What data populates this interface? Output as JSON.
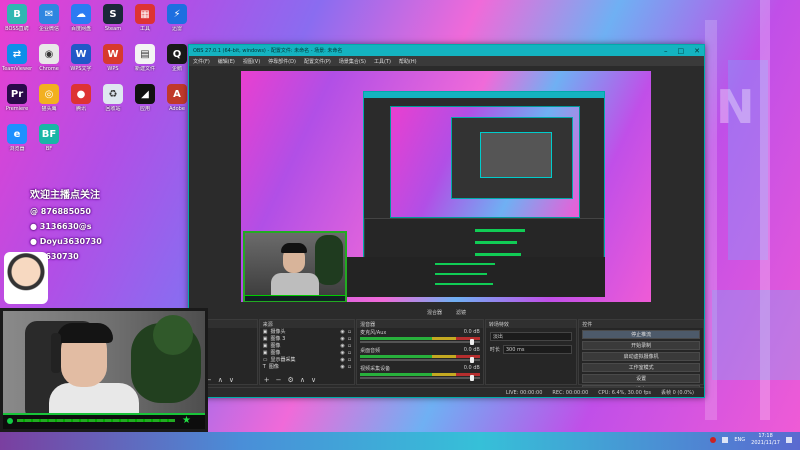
{
  "desktop": {
    "icons": [
      {
        "label": "BOSS直聘",
        "color": "#2fb7b2",
        "glyph": "B",
        "name": "boss-icon"
      },
      {
        "label": "企业微信",
        "color": "#2f86e0",
        "glyph": "✉",
        "name": "wecom-icon"
      },
      {
        "label": "百度网盘",
        "color": "#2c7bf2",
        "glyph": "☁",
        "name": "baidu-pan-icon"
      },
      {
        "label": "Steam",
        "color": "#1b2838",
        "glyph": "S",
        "name": "steam-icon"
      },
      {
        "label": "工具",
        "color": "#d33",
        "glyph": "▦",
        "name": "tool-icon"
      },
      {
        "label": "迅雷",
        "color": "#1d6fe0",
        "glyph": "⚡",
        "name": "xunlei-icon"
      },
      {
        "label": "TeamViewer",
        "color": "#0e8ee9",
        "glyph": "⇄",
        "name": "teamviewer-icon"
      },
      {
        "label": "Chrome",
        "color": "#e8e8e8",
        "glyph": "◉",
        "name": "chrome-icon"
      },
      {
        "label": "WPS文字",
        "color": "#2258c7",
        "glyph": "W",
        "name": "wps-word-icon"
      },
      {
        "label": "WPS",
        "color": "#d73a2e",
        "glyph": "W",
        "name": "wps-icon"
      },
      {
        "label": "新建文件",
        "color": "#f4f4f4",
        "glyph": "▤",
        "name": "file-icon"
      },
      {
        "label": "企鹅",
        "color": "#1a1a1a",
        "glyph": "Q",
        "name": "qq-icon"
      },
      {
        "label": "Premiere",
        "color": "#2a0a4a",
        "glyph": "Pr",
        "name": "premiere-icon"
      },
      {
        "label": "猫头鹰",
        "color": "#f2b020",
        "glyph": "◎",
        "name": "owl-icon"
      },
      {
        "label": "腾讯",
        "color": "#d33",
        "glyph": "●",
        "name": "tencent-icon"
      },
      {
        "label": "回收站",
        "color": "#dfe7f0",
        "glyph": "♻",
        "name": "recycle-icon"
      },
      {
        "label": "应用",
        "color": "#111",
        "glyph": "◢",
        "name": "app-icon"
      },
      {
        "label": "Adobe",
        "color": "#c0392b",
        "glyph": "A",
        "name": "adobe-icon"
      },
      {
        "label": "浏览器",
        "color": "#1e90ff",
        "glyph": "e",
        "name": "browser-icon"
      },
      {
        "label": "BF",
        "color": "#18b6a6",
        "glyph": "BF",
        "name": "bf-icon"
      }
    ],
    "overlay_lines": [
      "欢迎主播点关注",
      "@ 876885050",
      "● 3136630@s",
      "● Doyu3630730",
      "◎ 3630730"
    ]
  },
  "obs": {
    "title": "OBS 27.0.1 (64-bit, windows) - 配置文件: 未命名 - 场景: 未命名",
    "menu": [
      "文件(F)",
      "编辑(E)",
      "视图(V)",
      "停靠部件(D)",
      "配置文件(P)",
      "场景集合(S)",
      "工具(T)",
      "帮助(H)"
    ],
    "preview_tabs": [
      "混合器",
      "滤镜"
    ],
    "docks": {
      "scenes": {
        "header": "场景"
      },
      "sources": {
        "header": "来源",
        "items": [
          "摄像头",
          "图像 3",
          "图像",
          "图像",
          "显示器采集",
          "图像"
        ]
      },
      "mixer": {
        "header": "混音器",
        "channels": [
          {
            "name": "麦克风/Aux",
            "db": "0.0 dB"
          },
          {
            "name": "桌面音频",
            "db": "0.0 dB"
          },
          {
            "name": "视频采集设备",
            "db": "0.0 dB"
          }
        ]
      },
      "transitions": {
        "header": "转场特效",
        "type": "淡出",
        "duration_label": "时长",
        "duration": "300 ms"
      },
      "controls": {
        "header": "控件",
        "buttons": [
          "停止推流",
          "开始录制",
          "启动虚拟摄像机",
          "工作室模式",
          "设置",
          "退出"
        ]
      }
    },
    "status": {
      "live": "LIVE: 00:00:00",
      "rec": "REC: 00:00:00",
      "cpu": "CPU: 6.4%, 30.00 fps",
      "dropped": "丢帧 0 (0.0%)"
    }
  },
  "taskbar": {
    "lang": "ENG",
    "time": "17:18",
    "date": "2021/11/17"
  }
}
